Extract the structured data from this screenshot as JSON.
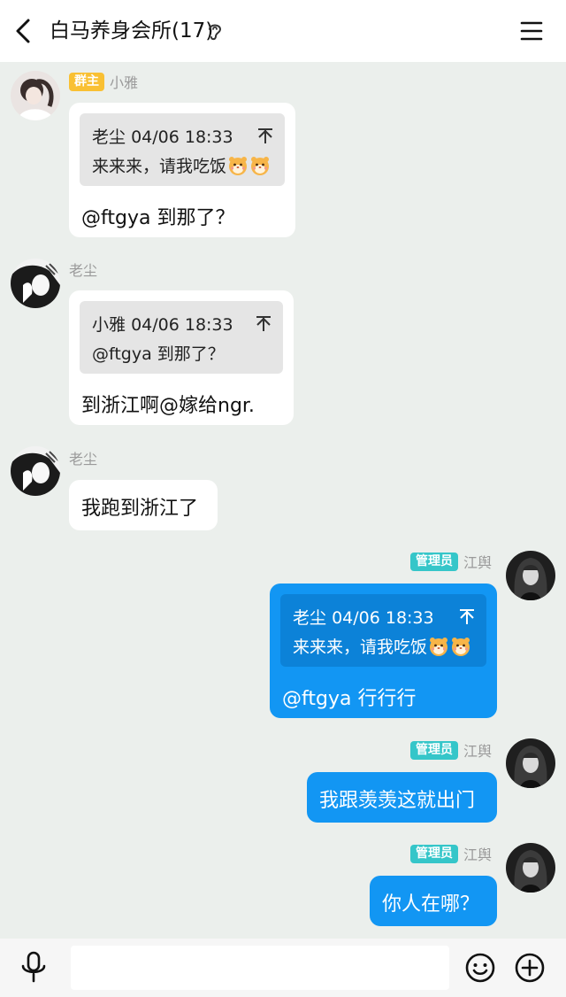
{
  "header": {
    "title": "白马养身会所(17)",
    "back_icon": "chevron-left-icon",
    "ear_icon": "ear-icon",
    "menu_icon": "menu-icon"
  },
  "messages": [
    {
      "sender": "小雅",
      "badge": "群主",
      "quote": {
        "author": "老尘",
        "time": "04/06 18:33",
        "text": "来来来，请我吃饭",
        "emoji_count": 2
      },
      "text": "@ftgya 到那了？"
    },
    {
      "sender": "老尘",
      "quote": {
        "author": "小雅",
        "time": "04/06 18:33",
        "text": "@ftgya 到那了？"
      },
      "text": "到浙江啊@嫁给ngr."
    },
    {
      "sender": "老尘",
      "text": "我跑到浙江了"
    },
    {
      "sender": "江舆",
      "badge": "管理员",
      "quote": {
        "author": "老尘",
        "time": "04/06 18:33",
        "text": "来来来，请我吃饭",
        "emoji_count": 2
      },
      "text": "@ftgya 行行行"
    },
    {
      "sender": "江舆",
      "badge": "管理员",
      "text": "我跟羡羡这就出门"
    },
    {
      "sender": "江舆",
      "badge": "管理员",
      "text": "你人在哪？"
    }
  ],
  "input_bar": {
    "placeholder": "",
    "mic_icon": "microphone-icon",
    "emoji_icon": "smiley-icon",
    "plus_icon": "plus-circle-icon"
  },
  "colors": {
    "background": "#ebefec",
    "bubble_in": "#ffffff",
    "bubble_out": "#1296f3",
    "quote_in": "#e5e5e5",
    "quote_out": "#0c82d8",
    "badge_owner": "#f9c033",
    "badge_admin": "#35c6c9"
  }
}
